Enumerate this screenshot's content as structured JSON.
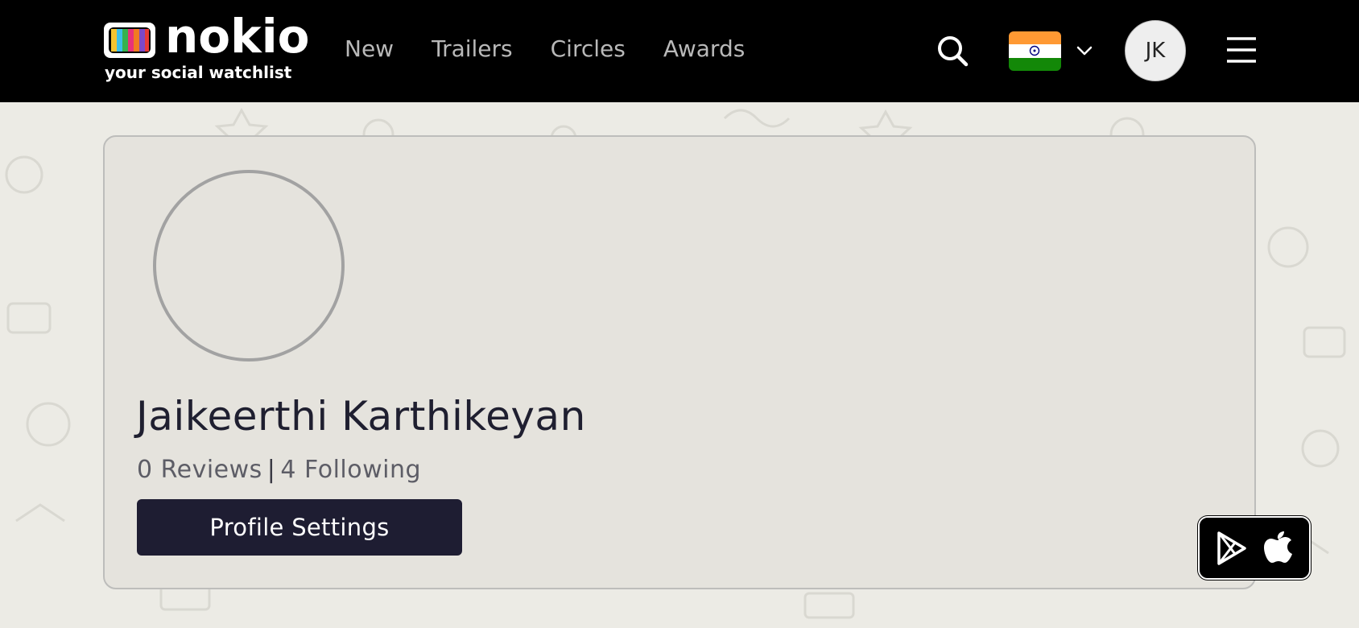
{
  "header": {
    "logo_word": "nokio",
    "logo_tagline": "your social watchlist",
    "nav": [
      "New",
      "Trailers",
      "Circles",
      "Awards"
    ],
    "user_initials": "JK",
    "country_flag": "india-flag-icon",
    "colors": {
      "background": "#000000",
      "nav_text": "#b9b9b9"
    }
  },
  "profile": {
    "name": "Jaikeerthi Karthikeyan",
    "reviews_label": "0 Reviews",
    "following_label": "4 Following",
    "settings_label": "Profile Settings"
  },
  "floating": {
    "icons": [
      "google-play-icon",
      "apple-icon"
    ]
  },
  "colors": {
    "page_bg": "#ecebe5",
    "card_bg": "#e5e3dd",
    "button_bg": "#1e1d32"
  }
}
